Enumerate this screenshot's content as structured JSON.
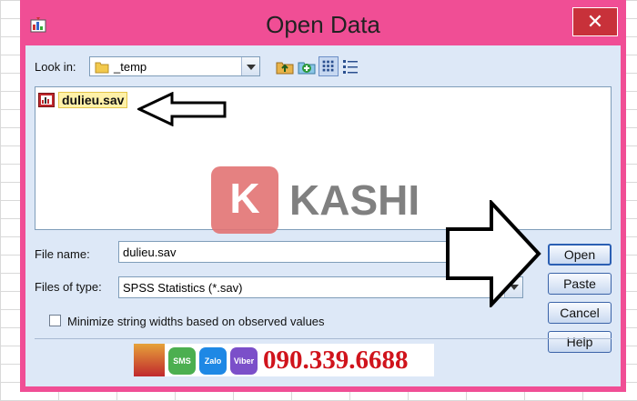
{
  "dialog": {
    "title": "Open Data",
    "close_glyph": "✕"
  },
  "look_in": {
    "label": "Look in:",
    "value": "_temp",
    "icon": "folder-icon"
  },
  "toolbar": {
    "icons": [
      "up-folder-icon",
      "new-folder-icon",
      "list-view-icon",
      "details-view-icon"
    ]
  },
  "files": [
    {
      "name": "dulieu.sav",
      "icon": "sav-file-icon"
    }
  ],
  "file_name": {
    "label": "File name:",
    "value": "dulieu.sav"
  },
  "files_of_type": {
    "label": "Files of type:",
    "value": "SPSS Statistics (*.sav)"
  },
  "minimize_option": {
    "label": "Minimize string widths based on observed values",
    "checked": false
  },
  "buttons": {
    "open": "Open",
    "paste": "Paste",
    "cancel": "Cancel",
    "help": "Help"
  },
  "watermark": {
    "letter": "K",
    "text": "KASHI"
  },
  "contact_bar": {
    "phone": "090.339.6688",
    "sms": "SMS",
    "zalo": "Zalo",
    "viber": "Viber"
  },
  "colors": {
    "frame": "#f04e95",
    "close": "#c8313a",
    "client": "#dde8f7",
    "phone": "#d0141c"
  }
}
